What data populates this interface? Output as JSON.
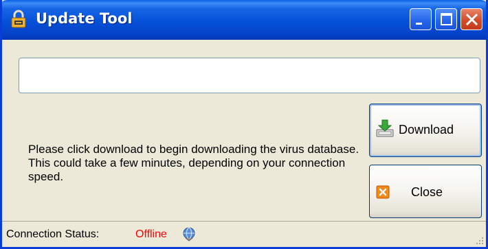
{
  "window": {
    "title": "Update Tool",
    "icon": "lock-icon"
  },
  "titlebar_buttons": [
    "minimize-button",
    "maximize-button",
    "close-window-button"
  ],
  "url_field": {
    "value": "",
    "placeholder": ""
  },
  "message": "Please click download to begin downloading the virus database. This could take a few minutes, depending on your connection speed.",
  "buttons": {
    "download_label": "Download",
    "download_icon": "download-icon",
    "close_label": "Close",
    "close_icon": "close-x-icon"
  },
  "status": {
    "label": "Connection Status:",
    "value": "Offline",
    "value_color": "#ff0000",
    "icon": "globe-icon"
  },
  "colors": {
    "titlebar": "#0451d8",
    "window_bg": "#ece9d8",
    "close_button": "#d44b2a"
  }
}
